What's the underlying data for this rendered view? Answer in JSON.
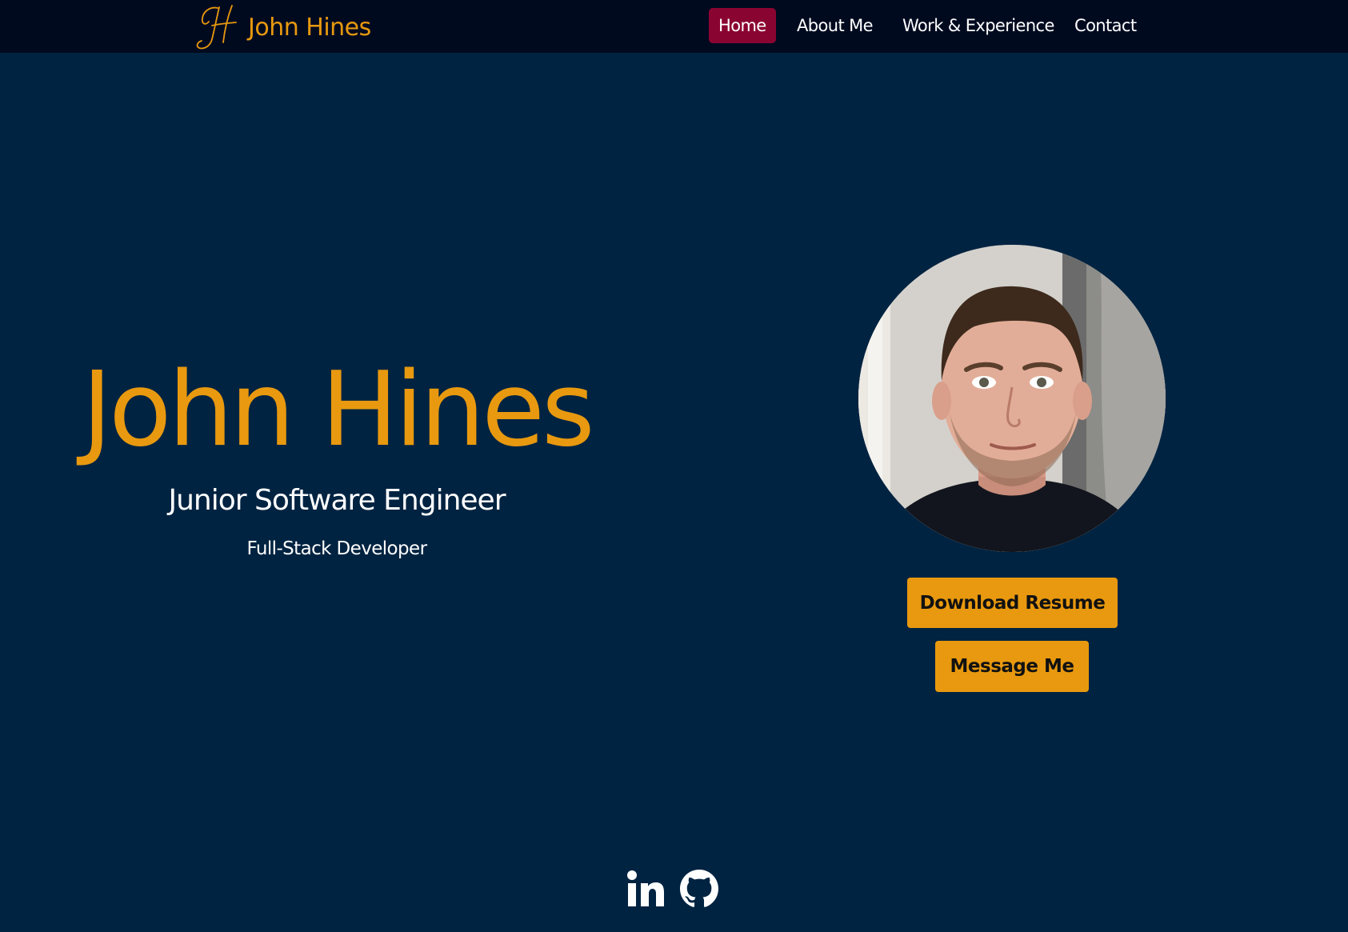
{
  "brand": {
    "name": "John Hines",
    "logo_icon": "jh-monogram-icon",
    "accent_color": "#e8990f"
  },
  "nav": {
    "items": [
      {
        "label": "Home",
        "active": true
      },
      {
        "label": "About Me",
        "active": false
      },
      {
        "label": "Work & Experience",
        "active": false
      },
      {
        "label": "Contact",
        "active": false
      }
    ],
    "active_color": "#8a0432"
  },
  "hero": {
    "title": "John Hines",
    "subtitle": "Junior Software Engineer",
    "role": "Full-Stack Developer"
  },
  "profile": {
    "photo_icon": "profile-photo"
  },
  "actions": {
    "download_resume": "Download Resume",
    "message_me": "Message Me"
  },
  "socials": [
    {
      "icon": "linkedin-icon"
    },
    {
      "icon": "github-icon"
    }
  ],
  "colors": {
    "background": "#002341",
    "navbar": "#000a1f",
    "accent": "#e8990f",
    "active_nav": "#8a0432"
  }
}
